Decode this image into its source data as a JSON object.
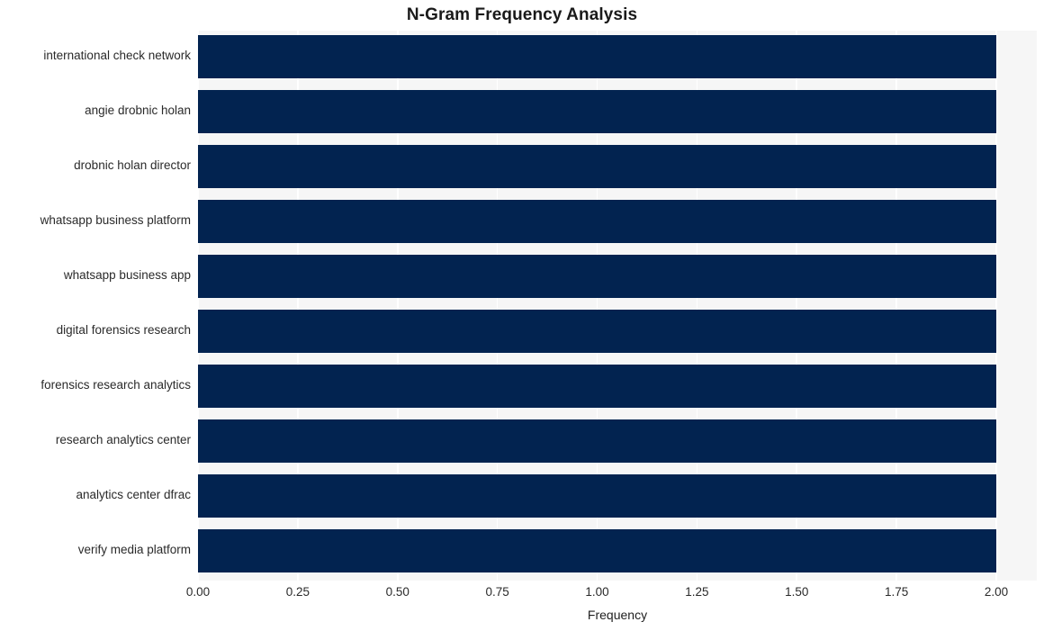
{
  "chart_data": {
    "type": "bar",
    "orientation": "horizontal",
    "title": "N-Gram Frequency Analysis",
    "xlabel": "Frequency",
    "ylabel": "",
    "categories": [
      "international check network",
      "angie drobnic holan",
      "drobnic holan director",
      "whatsapp business platform",
      "whatsapp business app",
      "digital forensics research",
      "forensics research analytics",
      "research analytics center",
      "analytics center dfrac",
      "verify media platform"
    ],
    "values": [
      2,
      2,
      2,
      2,
      2,
      2,
      2,
      2,
      2,
      2
    ],
    "xlim": [
      0.0,
      2.0
    ],
    "xticks": [
      0.0,
      0.25,
      0.5,
      0.75,
      1.0,
      1.25,
      1.5,
      1.75,
      2.0
    ],
    "xtick_labels": [
      "0.00",
      "0.25",
      "0.50",
      "0.75",
      "1.00",
      "1.25",
      "1.50",
      "1.75",
      "2.00"
    ],
    "grid": true,
    "grid_axis": "x",
    "legend": null,
    "bar_color": "#022350",
    "plot_background": "#f6f6f6",
    "grid_color": "#ffffff",
    "figure_background": "#ffffff",
    "text_color": "#2a2a2a"
  }
}
